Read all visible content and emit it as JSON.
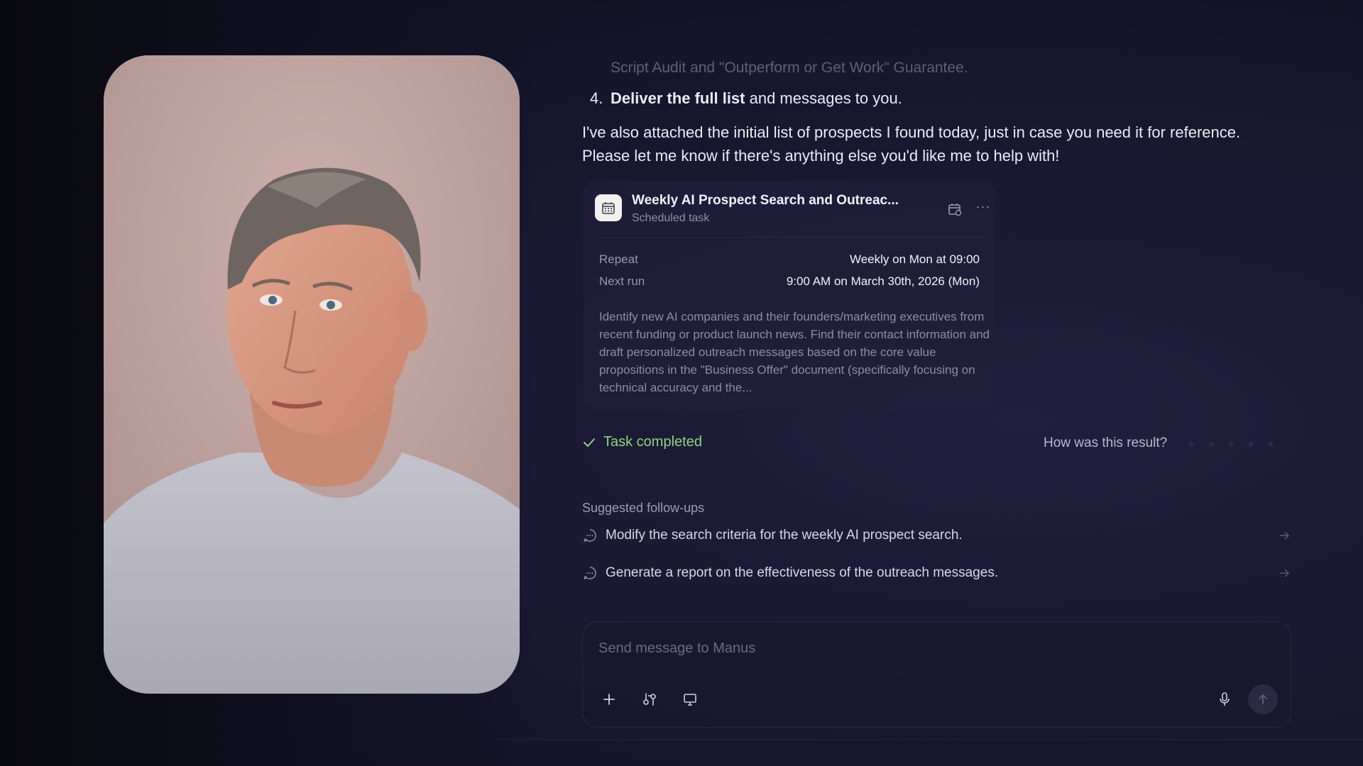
{
  "chat": {
    "faded_previous_line": "Script Audit and \"Outperform or Get Work\" Guarantee.",
    "list_item": {
      "number": "4.",
      "bold": "Deliver the full list",
      "rest": " and messages to you."
    },
    "paragraph_line1": "I've also attached the initial list of prospects I found today, just in case you need it for reference.",
    "paragraph_line2": "Please let me know if there's anything else you'd like me to help with!"
  },
  "task_card": {
    "icon": "calendar-icon",
    "title": "Weekly AI Prospect Search and Outreac...",
    "subtitle": "Scheduled task",
    "repeat_label": "Repeat",
    "repeat_value": "Weekly on Mon at 09:00",
    "next_run_label": "Next run",
    "next_run_value": "9:00 AM on March 30th, 2026 (Mon)",
    "description": "Identify new AI companies and their founders/marketing executives from recent funding or product launch news. Find their contact information and draft personalized outreach messages based on the core value propositions in the \"Business Offer\" document (specifically focusing on technical accuracy and the..."
  },
  "status": {
    "completed_label": "Task completed",
    "rating_prompt": "How was this result?",
    "stars": 5
  },
  "followups": {
    "title": "Suggested follow-ups",
    "items": [
      {
        "label": "Modify the search criteria for the weekly AI prospect search."
      },
      {
        "label": "Generate a report on the effectiveness of the outreach messages."
      }
    ]
  },
  "composer": {
    "placeholder": "Send message to Manus",
    "buttons": [
      "plus-icon",
      "connectors-icon",
      "computer-icon",
      "microphone-icon",
      "send-arrow-icon"
    ]
  },
  "colors": {
    "accent_green": "#8fd27c",
    "background": "#1a1933"
  }
}
